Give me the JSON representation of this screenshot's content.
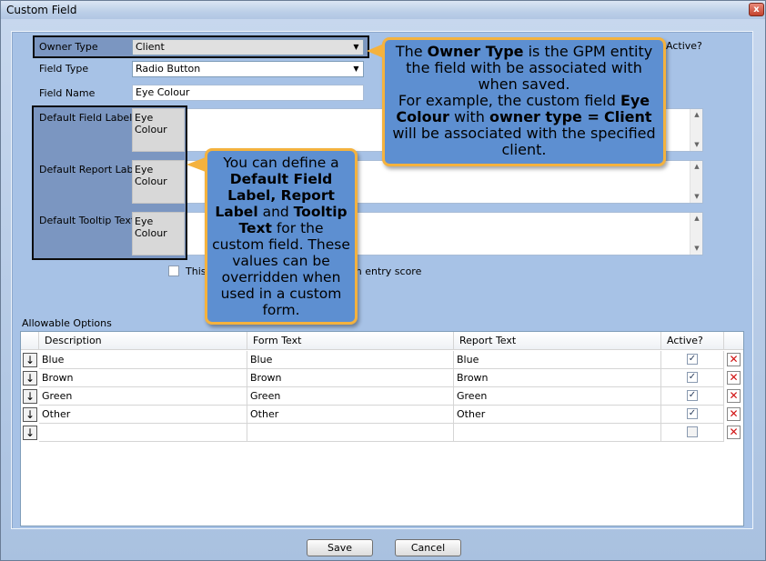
{
  "window": {
    "title": "Custom Field",
    "close_glyph": "x"
  },
  "form": {
    "owner_type_label": "Owner Type",
    "owner_type_value": "Client",
    "field_type_label": "Field Type",
    "field_type_value": "Radio Button",
    "field_name_label": "Field Name",
    "field_name_value": "Eye Colour",
    "default_field_label_label": "Default Field Label",
    "default_field_label_value": "Eye Colour",
    "default_report_label_label": "Default Report Label",
    "default_report_label_value": "Eye Colour",
    "default_tooltip_label": "Default Tooltip Text",
    "default_tooltip_value": "Eye Colour",
    "active_label": "Active?",
    "checkbox_text_start": "This",
    "checkbox_text_end": "m entry score"
  },
  "callouts": {
    "owner": {
      "t1": "The ",
      "b1": "Owner Type",
      "t2": " is the GPM entity the field with be associated with when saved.",
      "t3": "For example, the custom field ",
      "b2": "Eye Colour",
      "t4": " with ",
      "b3": "owner type =",
      "b4": "Client",
      "t5": " will be associated with the specified client."
    },
    "defaults": {
      "t1": "You can define a ",
      "b1": "Default Field Label, Report Label",
      "t2": " and ",
      "b2": "Tooltip Text",
      "t3": " for the custom field. These values can be overridden when used in a custom form."
    }
  },
  "options": {
    "section_label": "Allowable Options",
    "columns": [
      "Description",
      "Form Text",
      "Report Text",
      "Active?"
    ],
    "rows": [
      {
        "description": "Blue",
        "form_text": "Blue",
        "report_text": "Blue",
        "active": true
      },
      {
        "description": "Brown",
        "form_text": "Brown",
        "report_text": "Brown",
        "active": true
      },
      {
        "description": "Green",
        "form_text": "Green",
        "report_text": "Green",
        "active": true
      },
      {
        "description": "Other",
        "form_text": "Other",
        "report_text": "Other",
        "active": true
      },
      {
        "description": "",
        "form_text": "",
        "report_text": "",
        "active": false
      }
    ],
    "move_glyph": "↓",
    "delete_glyph": "✕",
    "check_glyph": "✓"
  },
  "buttons": {
    "save": "Save",
    "cancel": "Cancel"
  },
  "icons": {
    "close": "close-icon",
    "dropdown": "chevron-down-icon",
    "move": "arrow-down-icon",
    "delete": "delete-icon",
    "scroll_up": "scroll-up-icon",
    "scroll_down": "scroll-down-icon"
  },
  "colors": {
    "callout_fill": "#5d8fd1",
    "callout_border": "#f4b23e",
    "highlight_fill": "#7b96c1",
    "delete_red": "#d01010"
  }
}
